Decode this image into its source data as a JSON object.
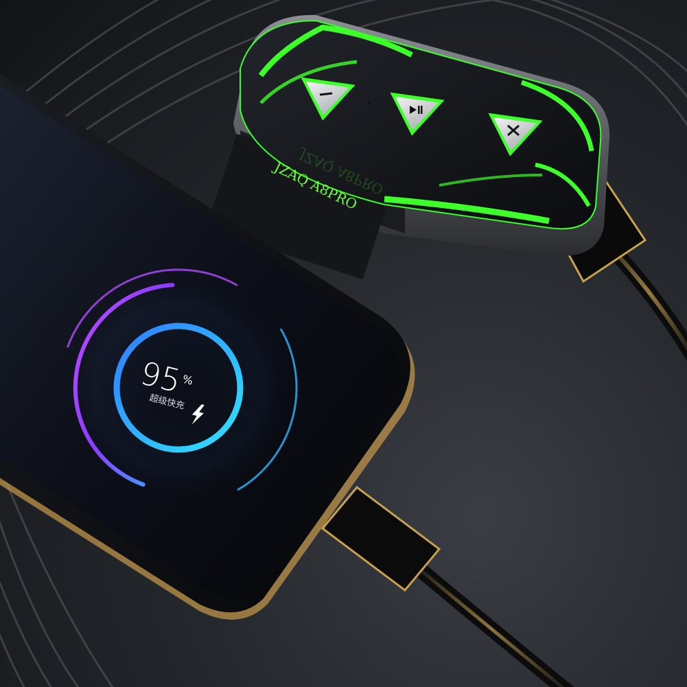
{
  "phone_screen": {
    "charge_percent": "95",
    "percent_unit": "%",
    "status_text": "超级快充",
    "charge_level": 0.95,
    "ring_colors": {
      "inner": "#2ed0ff",
      "outer_start": "#8a3cff",
      "outer_end": "#2fb6ff"
    }
  },
  "controller": {
    "model_label": "JZAQ A8PRO",
    "buttons": [
      {
        "icon": "minus-icon"
      },
      {
        "icon": "play-pause-icon"
      },
      {
        "icon": "close-icon"
      }
    ],
    "accent_color": "#3dff2a"
  }
}
